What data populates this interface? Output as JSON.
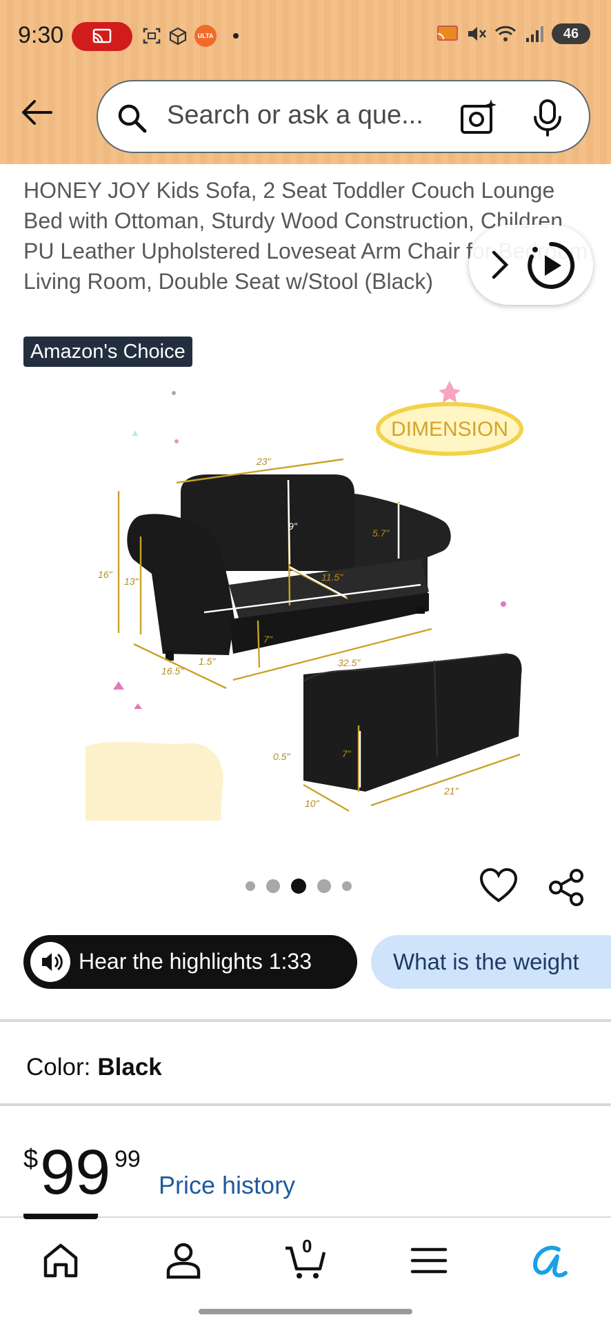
{
  "status_bar": {
    "time": "9:30",
    "battery": "46",
    "ulta_label": "ULTA"
  },
  "search": {
    "placeholder": "Search or ask a que..."
  },
  "product": {
    "title": "HONEY JOY Kids Sofa, 2 Seat Toddler Couch Lounge Bed with Ottoman, Sturdy Wood Construction, Children PU Leather Upholstered Loveseat Arm Chair for Bedroom Living Room, Double Seat w/Stool (Black)",
    "badge": "Amazon's Choice",
    "image_label": "DIMENSION",
    "dimensions": {
      "width": "23\"",
      "back_height": "9\"",
      "arm_height": "5.7\"",
      "seat_depth": "11.5\"",
      "total_height": "16\"",
      "arm_total": "13\"",
      "seat_height": "7\"",
      "depth": "16.5\"",
      "leg": "1.5\"",
      "length": "32.5\"",
      "ottoman_height": "7\"",
      "ottoman_leg": "0.5\"",
      "ottoman_depth": "10\"",
      "ottoman_length": "21\""
    },
    "carousel": {
      "count": 5,
      "active_index": 2
    }
  },
  "highlights": {
    "hear_label": "Hear the highlights 1:33",
    "question_label": "What is the weight"
  },
  "color": {
    "label": "Color:",
    "value": "Black"
  },
  "price": {
    "symbol": "$",
    "whole": "99",
    "fraction": "99",
    "history_label": "Price history"
  },
  "bottom_nav": {
    "cart_count": "0",
    "items": [
      "home-icon",
      "account-icon",
      "cart-icon",
      "menu-icon",
      "rufus-icon"
    ]
  },
  "colors": {
    "header_bg": "#f3c089",
    "badge_bg": "#232f3e",
    "link": "#1f5a9e",
    "question_pill": "#cfe4fa",
    "cast_red": "#d11c1c",
    "rufus_blue": "#1aa0e6"
  }
}
